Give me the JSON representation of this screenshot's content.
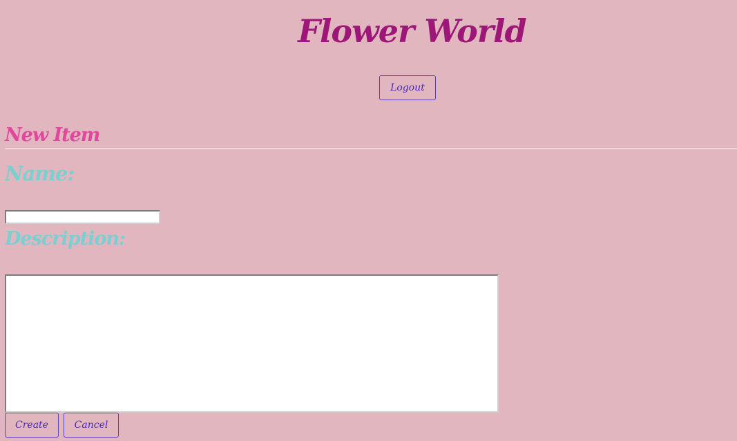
{
  "header": {
    "site_title": "Flower World",
    "logout_label": "Logout"
  },
  "form": {
    "heading": "New Item",
    "name_label": "Name:",
    "name_value": "",
    "description_label": "Description:",
    "description_value": "",
    "create_label": "Create",
    "cancel_label": "Cancel"
  },
  "colors": {
    "background": "#e2b6be",
    "title": "#9c1777",
    "heading": "#e0479f",
    "label": "#7ccfd0",
    "button_text": "#4a2bb0"
  }
}
